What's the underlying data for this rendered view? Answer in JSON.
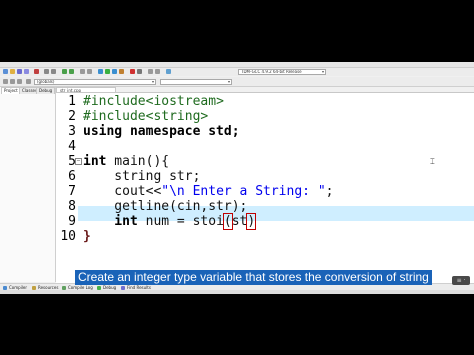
{
  "toolbar": {
    "compiler_select": "TDM-GCC 4.9.2 64-bit Release",
    "scope_select": "(globals)"
  },
  "left_panel": {
    "tabs": [
      "Project",
      "Classes",
      "Debug"
    ]
  },
  "editor": {
    "file_tab": "str_int.cpp",
    "line_numbers": [
      "1",
      "2",
      "3",
      "4",
      "5",
      "6",
      "7",
      "8",
      "9",
      "10"
    ],
    "code": {
      "l1_directive": "#include",
      "l1_header": "<iostream>",
      "l2_directive": "#include",
      "l2_header": "<string>",
      "l3": "using namespace std;",
      "l5_kw": "int",
      "l5_rest": " main(){",
      "l6": "    string str;",
      "l7_a": "    cout<<",
      "l7_str": "\"\\n Enter a String: \"",
      "l7_b": ";",
      "l8": "    getline(cin,str);",
      "l9_kw": "    int",
      "l9_rest": " num = stoi",
      "l9_paren": "(",
      "l9_tail": "st",
      "l9_close": ")",
      "l10": "}"
    },
    "fold_markers": [
      "−",
      "−"
    ]
  },
  "bottom_tabs": [
    "Compiler",
    "Resources",
    "Compile Log",
    "Debug",
    "Find Results"
  ],
  "subtitle": "Create an integer type variable that stores the conversion of string",
  "corner_button": "≡ ·",
  "colors": {
    "subtitle_bg": "#1a63b8",
    "current_line": "#cfeeff",
    "bracket_highlight": "#c00000",
    "string_literal": "#0000ee",
    "preprocessor": "#1f6b1f"
  }
}
